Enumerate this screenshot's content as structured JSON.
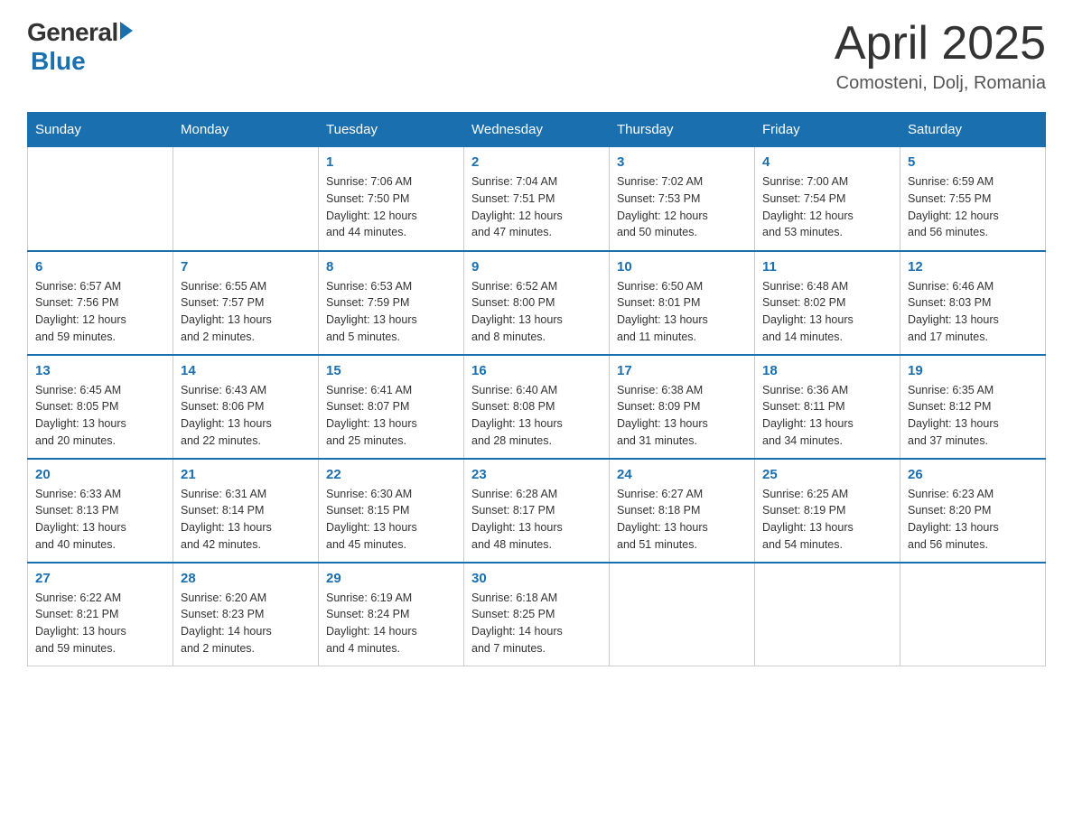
{
  "logo": {
    "general": "General",
    "blue": "Blue"
  },
  "title": "April 2025",
  "location": "Comosteni, Dolj, Romania",
  "days_of_week": [
    "Sunday",
    "Monday",
    "Tuesday",
    "Wednesday",
    "Thursday",
    "Friday",
    "Saturday"
  ],
  "weeks": [
    [
      {
        "day": "",
        "info": ""
      },
      {
        "day": "",
        "info": ""
      },
      {
        "day": "1",
        "info": "Sunrise: 7:06 AM\nSunset: 7:50 PM\nDaylight: 12 hours\nand 44 minutes."
      },
      {
        "day": "2",
        "info": "Sunrise: 7:04 AM\nSunset: 7:51 PM\nDaylight: 12 hours\nand 47 minutes."
      },
      {
        "day": "3",
        "info": "Sunrise: 7:02 AM\nSunset: 7:53 PM\nDaylight: 12 hours\nand 50 minutes."
      },
      {
        "day": "4",
        "info": "Sunrise: 7:00 AM\nSunset: 7:54 PM\nDaylight: 12 hours\nand 53 minutes."
      },
      {
        "day": "5",
        "info": "Sunrise: 6:59 AM\nSunset: 7:55 PM\nDaylight: 12 hours\nand 56 minutes."
      }
    ],
    [
      {
        "day": "6",
        "info": "Sunrise: 6:57 AM\nSunset: 7:56 PM\nDaylight: 12 hours\nand 59 minutes."
      },
      {
        "day": "7",
        "info": "Sunrise: 6:55 AM\nSunset: 7:57 PM\nDaylight: 13 hours\nand 2 minutes."
      },
      {
        "day": "8",
        "info": "Sunrise: 6:53 AM\nSunset: 7:59 PM\nDaylight: 13 hours\nand 5 minutes."
      },
      {
        "day": "9",
        "info": "Sunrise: 6:52 AM\nSunset: 8:00 PM\nDaylight: 13 hours\nand 8 minutes."
      },
      {
        "day": "10",
        "info": "Sunrise: 6:50 AM\nSunset: 8:01 PM\nDaylight: 13 hours\nand 11 minutes."
      },
      {
        "day": "11",
        "info": "Sunrise: 6:48 AM\nSunset: 8:02 PM\nDaylight: 13 hours\nand 14 minutes."
      },
      {
        "day": "12",
        "info": "Sunrise: 6:46 AM\nSunset: 8:03 PM\nDaylight: 13 hours\nand 17 minutes."
      }
    ],
    [
      {
        "day": "13",
        "info": "Sunrise: 6:45 AM\nSunset: 8:05 PM\nDaylight: 13 hours\nand 20 minutes."
      },
      {
        "day": "14",
        "info": "Sunrise: 6:43 AM\nSunset: 8:06 PM\nDaylight: 13 hours\nand 22 minutes."
      },
      {
        "day": "15",
        "info": "Sunrise: 6:41 AM\nSunset: 8:07 PM\nDaylight: 13 hours\nand 25 minutes."
      },
      {
        "day": "16",
        "info": "Sunrise: 6:40 AM\nSunset: 8:08 PM\nDaylight: 13 hours\nand 28 minutes."
      },
      {
        "day": "17",
        "info": "Sunrise: 6:38 AM\nSunset: 8:09 PM\nDaylight: 13 hours\nand 31 minutes."
      },
      {
        "day": "18",
        "info": "Sunrise: 6:36 AM\nSunset: 8:11 PM\nDaylight: 13 hours\nand 34 minutes."
      },
      {
        "day": "19",
        "info": "Sunrise: 6:35 AM\nSunset: 8:12 PM\nDaylight: 13 hours\nand 37 minutes."
      }
    ],
    [
      {
        "day": "20",
        "info": "Sunrise: 6:33 AM\nSunset: 8:13 PM\nDaylight: 13 hours\nand 40 minutes."
      },
      {
        "day": "21",
        "info": "Sunrise: 6:31 AM\nSunset: 8:14 PM\nDaylight: 13 hours\nand 42 minutes."
      },
      {
        "day": "22",
        "info": "Sunrise: 6:30 AM\nSunset: 8:15 PM\nDaylight: 13 hours\nand 45 minutes."
      },
      {
        "day": "23",
        "info": "Sunrise: 6:28 AM\nSunset: 8:17 PM\nDaylight: 13 hours\nand 48 minutes."
      },
      {
        "day": "24",
        "info": "Sunrise: 6:27 AM\nSunset: 8:18 PM\nDaylight: 13 hours\nand 51 minutes."
      },
      {
        "day": "25",
        "info": "Sunrise: 6:25 AM\nSunset: 8:19 PM\nDaylight: 13 hours\nand 54 minutes."
      },
      {
        "day": "26",
        "info": "Sunrise: 6:23 AM\nSunset: 8:20 PM\nDaylight: 13 hours\nand 56 minutes."
      }
    ],
    [
      {
        "day": "27",
        "info": "Sunrise: 6:22 AM\nSunset: 8:21 PM\nDaylight: 13 hours\nand 59 minutes."
      },
      {
        "day": "28",
        "info": "Sunrise: 6:20 AM\nSunset: 8:23 PM\nDaylight: 14 hours\nand 2 minutes."
      },
      {
        "day": "29",
        "info": "Sunrise: 6:19 AM\nSunset: 8:24 PM\nDaylight: 14 hours\nand 4 minutes."
      },
      {
        "day": "30",
        "info": "Sunrise: 6:18 AM\nSunset: 8:25 PM\nDaylight: 14 hours\nand 7 minutes."
      },
      {
        "day": "",
        "info": ""
      },
      {
        "day": "",
        "info": ""
      },
      {
        "day": "",
        "info": ""
      }
    ]
  ]
}
